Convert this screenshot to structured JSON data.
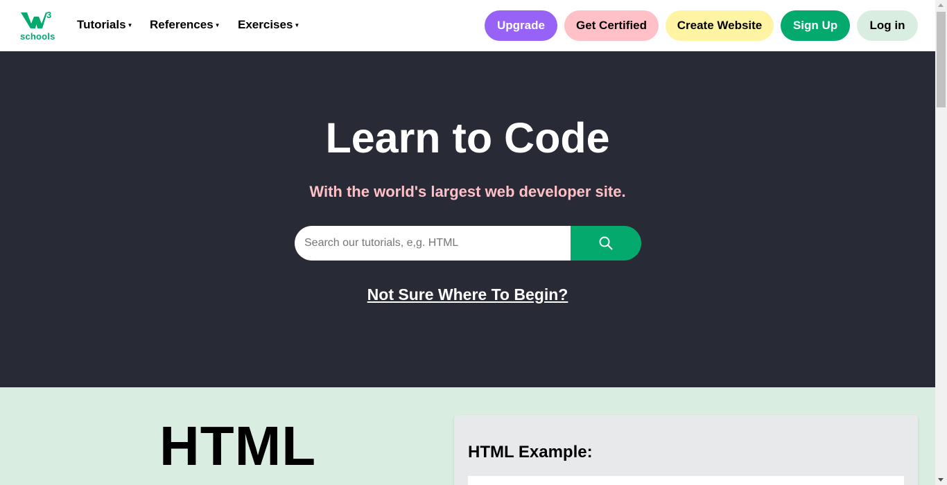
{
  "colors": {
    "brand_green": "#04AA6D",
    "hero_background": "#282A35",
    "subtitle_pink": "#FFC0C7",
    "section_mint": "#D9EEE1",
    "upgrade_purple": "#9763f6",
    "certified_pink": "#ffc0c7",
    "create_yellow": "#fff4a3",
    "login_mint": "#d9eee1",
    "card_gray": "#E7E9EB"
  },
  "header": {
    "logo": {
      "icon": "w3schools-logo",
      "superscript": "3",
      "text": "schools"
    },
    "menus": [
      {
        "label": "Tutorials",
        "icon": "caret-down-icon"
      },
      {
        "label": "References",
        "icon": "caret-down-icon"
      },
      {
        "label": "Exercises",
        "icon": "caret-down-icon"
      }
    ],
    "buttons": {
      "upgrade": "Upgrade",
      "get_certified": "Get Certified",
      "create_website": "Create Website",
      "sign_up": "Sign Up",
      "log_in": "Log in"
    }
  },
  "hero": {
    "title": "Learn to Code",
    "subtitle": "With the world's largest web developer site.",
    "search": {
      "placeholder": "Search our tutorials, e,g. HTML",
      "value": "",
      "button_icon": "search-icon"
    },
    "begin_link": "Not Sure Where To Begin?"
  },
  "html_section": {
    "title": "HTML",
    "example_heading": "HTML Example:"
  }
}
